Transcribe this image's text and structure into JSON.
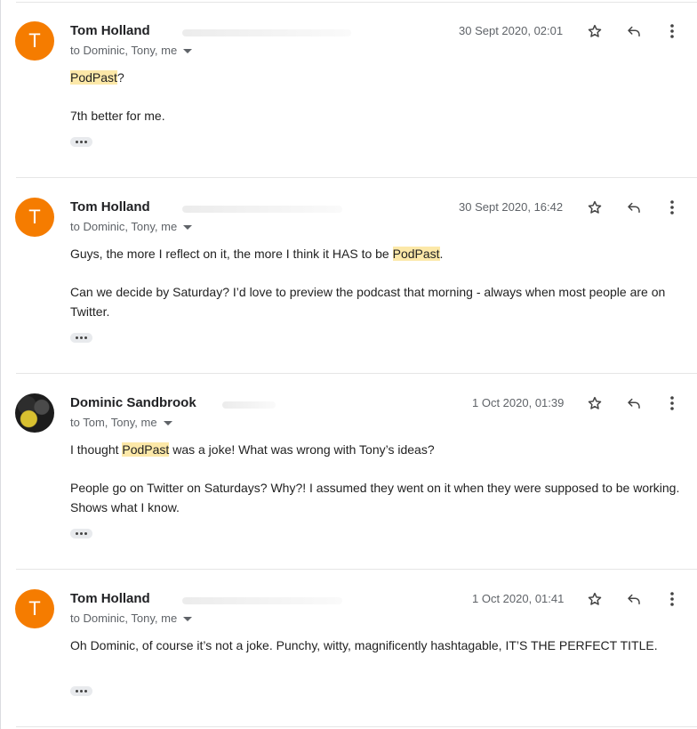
{
  "messages": [
    {
      "avatar_letter": "T",
      "sender": "Tom Holland",
      "recipients": "to Dominic, Tony, me",
      "date": "30 Sept 2020, 02:01",
      "paragraphs": [
        [
          {
            "text": "PodPast",
            "highlight": true
          },
          {
            "text": "?"
          }
        ],
        [
          {
            "text": "7th better for me."
          }
        ]
      ]
    },
    {
      "avatar_letter": "T",
      "sender": "Tom Holland",
      "recipients": "to Dominic, Tony, me",
      "date": "30 Sept 2020, 16:42",
      "paragraphs": [
        [
          {
            "text": "Guys, the more I reflect on it, the more I think it HAS to be "
          },
          {
            "text": "PodPast",
            "highlight": true
          },
          {
            "text": "."
          }
        ],
        [
          {
            "text": "Can we decide by Saturday? I’d love to preview the podcast that morning - always when most people are on Twitter."
          }
        ]
      ]
    },
    {
      "avatar_letter": "",
      "sender": "Dominic Sandbrook",
      "recipients": "to Tom, Tony, me",
      "date": "1 Oct 2020, 01:39",
      "paragraphs": [
        [
          {
            "text": "I thought "
          },
          {
            "text": "PodPast",
            "highlight": true
          },
          {
            "text": " was a joke! What was wrong with Tony’s ideas?"
          }
        ],
        [
          {
            "text": "People go on Twitter on Saturdays? Why?! I assumed they went on it when they were supposed to be working. Shows what I know."
          }
        ]
      ]
    },
    {
      "avatar_letter": "T",
      "sender": "Tom Holland",
      "recipients": "to Dominic, Tony, me",
      "date": "1 Oct 2020, 01:41",
      "paragraphs": [
        [
          {
            "text": "Oh Dominic, of course it’s not a joke. Punchy, witty, magnificently hashtagable, IT’S THE PERFECT TITLE."
          }
        ]
      ]
    }
  ],
  "icons": {
    "star": "star-outline-icon",
    "reply": "reply-arrow-icon",
    "more": "more-vertical-icon",
    "caret": "caret-down-icon",
    "expand": "ellipsis-icon"
  },
  "colors": {
    "avatar": "#f57c00",
    "highlight": "#fce8a8",
    "muted_text": "#5f6368"
  }
}
